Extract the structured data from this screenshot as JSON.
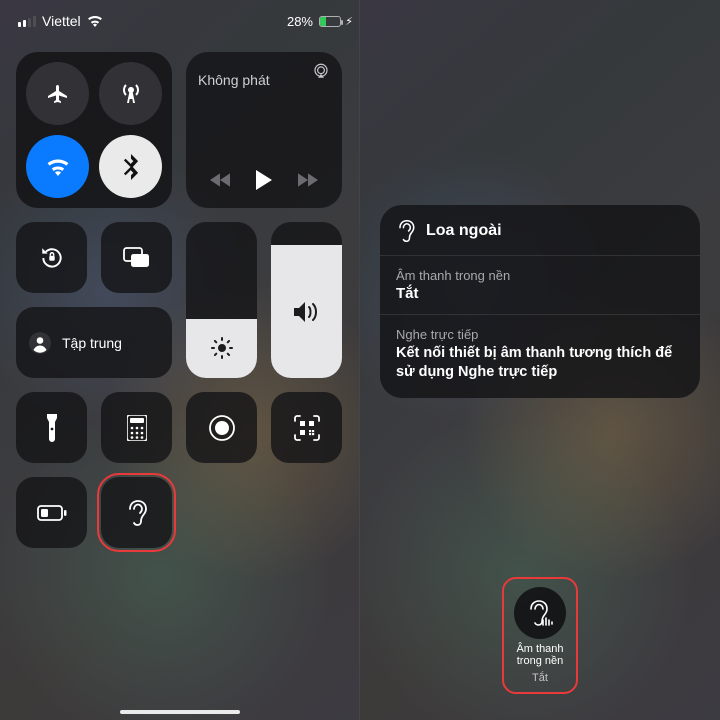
{
  "status": {
    "carrier": "Viettel",
    "battery_pct": "28%"
  },
  "connectivity": {
    "airplane_icon": "airplane-icon",
    "cellular_icon": "antenna-icon",
    "wifi_icon": "wifi-icon",
    "bluetooth_icon": "bluetooth-icon"
  },
  "media": {
    "now_playing": "Không phát"
  },
  "focus": {
    "label": "Tập trung"
  },
  "hearing_panel": {
    "header": "Loa ngoài",
    "bg_sounds_label": "Âm thanh trong nền",
    "bg_sounds_value": "Tắt",
    "live_listen_label": "Nghe trực tiếp",
    "live_listen_msg": "Kết nối thiết bị âm thanh tương thích để sử dụng Nghe trực tiếp"
  },
  "hearing_button": {
    "label_line1": "Âm thanh",
    "label_line2": "trong nền",
    "state": "Tắt"
  }
}
